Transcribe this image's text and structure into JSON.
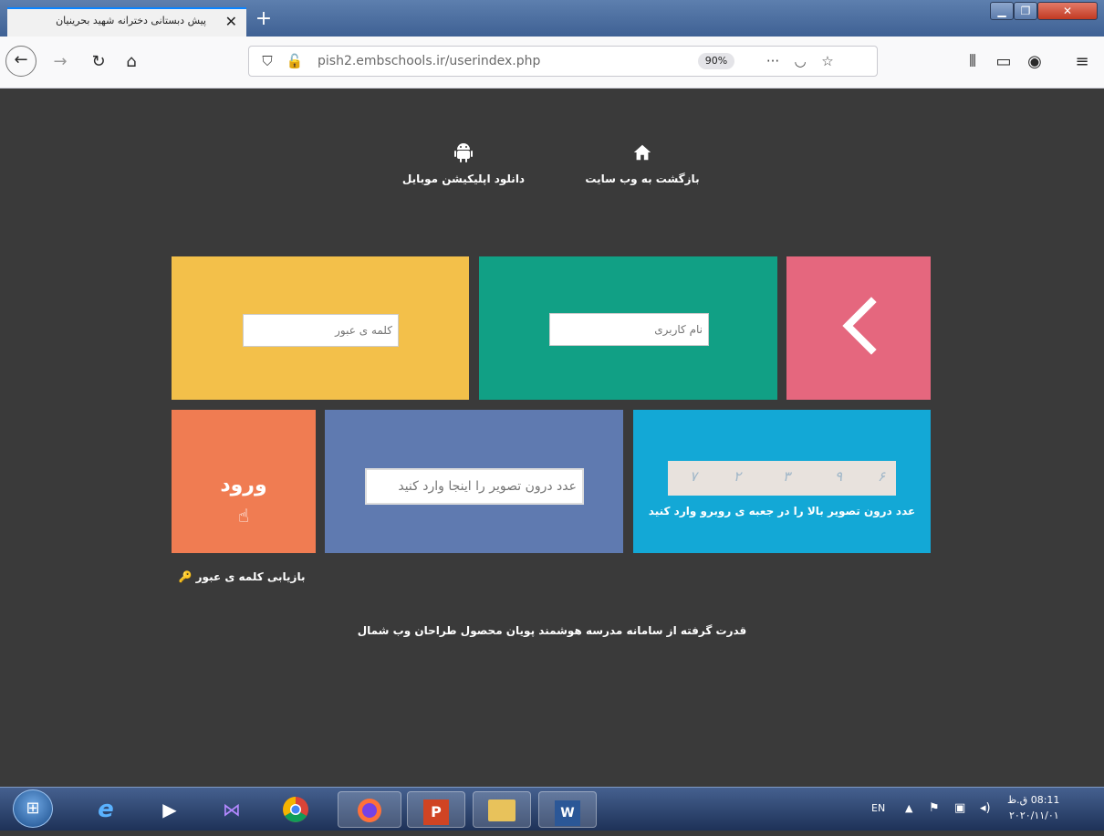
{
  "browser": {
    "tab_title": "پیش دبستانی دخترانه شهید بحرینیان",
    "tab_close": "✕",
    "new_tab": "+",
    "url": "pish2.embschools.ir/userindex.php",
    "zoom": "90%"
  },
  "links": {
    "website_label": "بازگشت به وب سایت",
    "app_label": "دانلود اپلیکیشن موبایل"
  },
  "form": {
    "password_placeholder": "کلمه ی عبور",
    "username_placeholder": "نام کاربری",
    "captcha_placeholder": "عدد درون تصویر را اینجا وارد کنید",
    "login_label": "ورود",
    "captcha_digits": [
      "۶",
      "۹",
      "۳",
      "۲",
      "۷"
    ],
    "captcha_hint": "عدد درون تصویر بالا را در جعبه ی روبرو وارد کنید",
    "recover_label": "بازیابی کلمه ی عبور"
  },
  "footer": {
    "text": "قدرت گرفته از سامانه مدرسه هوشمند پویان محصول طراحان وب شمال"
  },
  "taskbar": {
    "lang": "EN",
    "time": "08:11 ق.ظ",
    "date": "۲۰۲۰/۱۱/۰۱"
  },
  "colors": {
    "page_bg": "#3a3a3a",
    "password_tile": "#f3c04a",
    "username_tile": "#11a085",
    "back_tile": "#e5677e",
    "login_tile": "#f07c52",
    "captcha_input_tile": "#5f7ab0",
    "captcha_tile": "#13a8d6"
  },
  "icons": [
    "home-icon",
    "android-icon",
    "chevron-left-icon",
    "hand-pointer-icon",
    "key-icon"
  ]
}
